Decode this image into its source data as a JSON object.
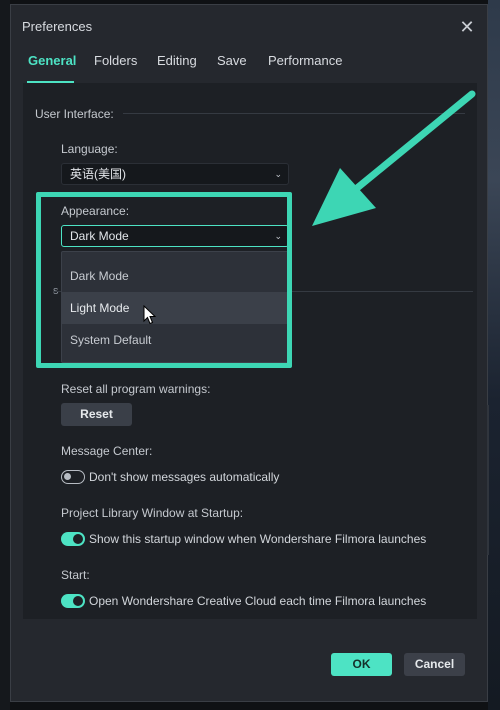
{
  "dialog": {
    "title": "Preferences"
  },
  "tabs": [
    {
      "label": "General"
    },
    {
      "label": "Folders"
    },
    {
      "label": "Editing"
    },
    {
      "label": "Save"
    },
    {
      "label": "Performance"
    }
  ],
  "sections": {
    "user_interface": "User Interface:",
    "language_label": "Language:",
    "language_value": "英语(美国)",
    "appearance_label": "Appearance:",
    "appearance_value": "Dark Mode",
    "appearance_options": [
      "Dark Mode",
      "Light Mode",
      "System Default"
    ],
    "stray_char": "s",
    "reset_warnings_label": "Reset all program warnings:",
    "reset_button": "Reset",
    "message_center_label": "Message Center:",
    "message_center_toggle": "Don't show messages automatically",
    "project_library_label": "Project Library Window at Startup:",
    "project_library_toggle": "Show this startup window when Wondershare Filmora launches",
    "start_label": "Start:",
    "start_toggle": "Open Wondershare Creative Cloud each time Filmora launches"
  },
  "toggles": {
    "message_center_on": false,
    "project_library_on": true,
    "start_on": true
  },
  "footer": {
    "ok": "OK",
    "cancel": "Cancel"
  },
  "colors": {
    "accent": "#4de3c4",
    "highlight": "#3dd6b4",
    "background": "#25282e"
  }
}
